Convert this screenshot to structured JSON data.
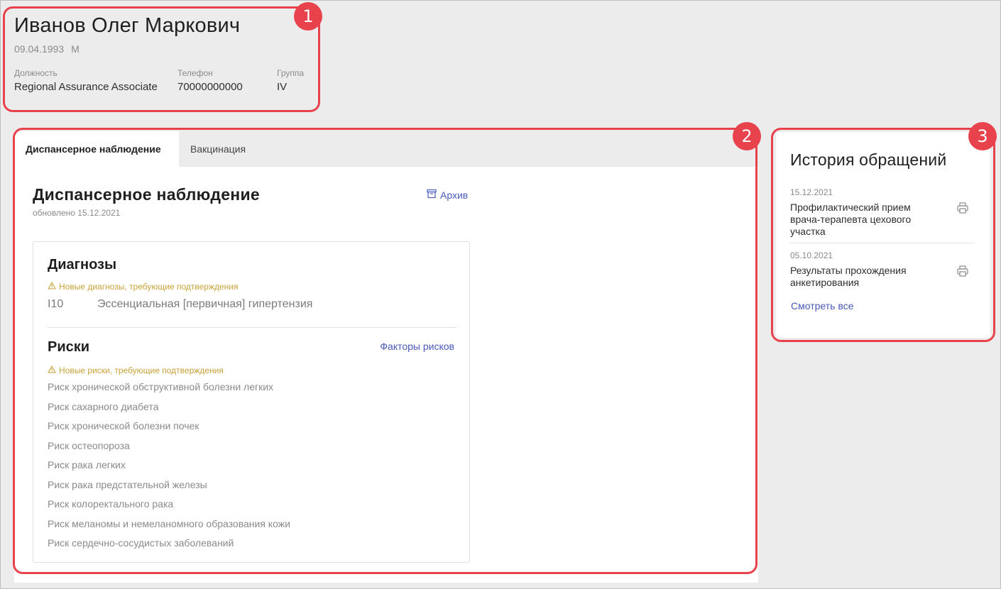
{
  "patient": {
    "name": "Иванов Олег Маркович",
    "birthdate": "09.04.1993",
    "sex": "М",
    "position_label": "Должность",
    "position_value": "Regional Assurance Associate",
    "phone_label": "Телефон",
    "phone_value": "70000000000",
    "group_label": "Группа",
    "group_value": "IV"
  },
  "tabs": [
    {
      "label": "Диспансерное наблюдение",
      "active": true
    },
    {
      "label": "Вакцинация",
      "active": false
    }
  ],
  "dispensary": {
    "title": "Диспансерное наблюдение",
    "updated": "обновлено 15.12.2021",
    "archive_label": "Архив",
    "diagnoses": {
      "title": "Диагнозы",
      "warning": "Новые диагнозы, требующие подтверждения",
      "items": [
        {
          "code": "I10",
          "name": "Эссенциальная [первичная] гипертензия"
        }
      ]
    },
    "risks": {
      "title": "Риски",
      "factors_link": "Факторы рисков",
      "warning": "Новые риски, требующие подтверждения",
      "items": [
        "Риск хронической обструктивной болезни легких",
        "Риск сахарного диабета",
        "Риск хронической болезни почек",
        "Риск остеопороза",
        "Риск рака легких",
        "Риск рака предстательной железы",
        "Риск колоректального рака",
        "Риск меланомы и немеланомного образования кожи",
        "Риск сердечно-сосудистых заболеваний"
      ]
    }
  },
  "history": {
    "title": "История обращений",
    "items": [
      {
        "date": "15.12.2021",
        "text": "Профилактический прием врача-терапевта цехового участка"
      },
      {
        "date": "05.10.2021",
        "text": "Результаты прохождения анкетирования"
      }
    ],
    "see_all": "Смотреть все"
  },
  "annotations": [
    "1",
    "2",
    "3"
  ],
  "colors": {
    "accent": "#4a5ab8",
    "warning": "#c8a23a",
    "annotation": "#e8434d",
    "background": "#ececed"
  }
}
